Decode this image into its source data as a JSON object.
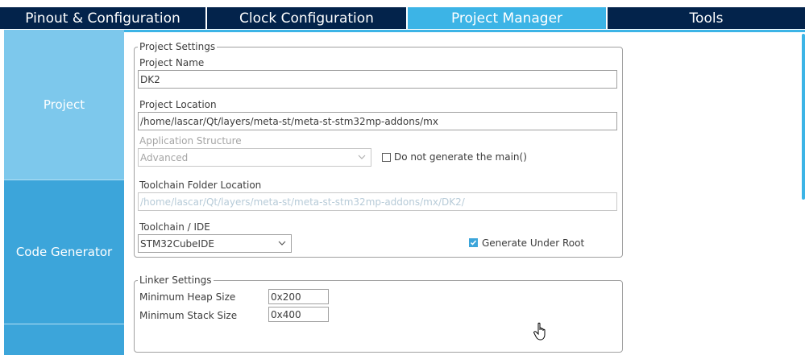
{
  "tabs": [
    {
      "label": "Pinout & Configuration"
    },
    {
      "label": "Clock Configuration"
    },
    {
      "label": "Project Manager"
    },
    {
      "label": "Tools"
    }
  ],
  "sidebar": {
    "items": [
      {
        "label": "Project"
      },
      {
        "label": "Code Generator"
      },
      {
        "label": ""
      }
    ]
  },
  "project_settings": {
    "legend": "Project Settings",
    "project_name_label": "Project Name",
    "project_name_value": "DK2",
    "project_location_label": "Project Location",
    "project_location_value": "/home/lascar/Qt/layers/meta-st/meta-st-stm32mp-addons/mx",
    "app_structure_label": "Application Structure",
    "app_structure_value": "Advanced",
    "no_main_label": "Do not generate the main()",
    "toolchain_folder_label": "Toolchain Folder Location",
    "toolchain_folder_value": "/home/lascar/Qt/layers/meta-st/meta-st-stm32mp-addons/mx/DK2/",
    "toolchain_ide_label": "Toolchain / IDE",
    "toolchain_ide_value": "STM32CubeIDE",
    "generate_root_label": "Generate Under Root"
  },
  "linker_settings": {
    "legend": "Linker Settings",
    "heap_label": "Minimum Heap Size",
    "heap_value": "0x200",
    "stack_label": "Minimum Stack Size",
    "stack_value": "0x400"
  },
  "colors": {
    "tab_dark": "#03234b",
    "tab_active": "#3cb4e6",
    "sidebar": "#3ca5da",
    "sidebar_selected": "#7dc8ec"
  },
  "icons": {
    "cursor": "hand-pointer-icon",
    "combo_arrow": "chevron-down-icon",
    "checkbox_checked": "checkmark-icon"
  }
}
